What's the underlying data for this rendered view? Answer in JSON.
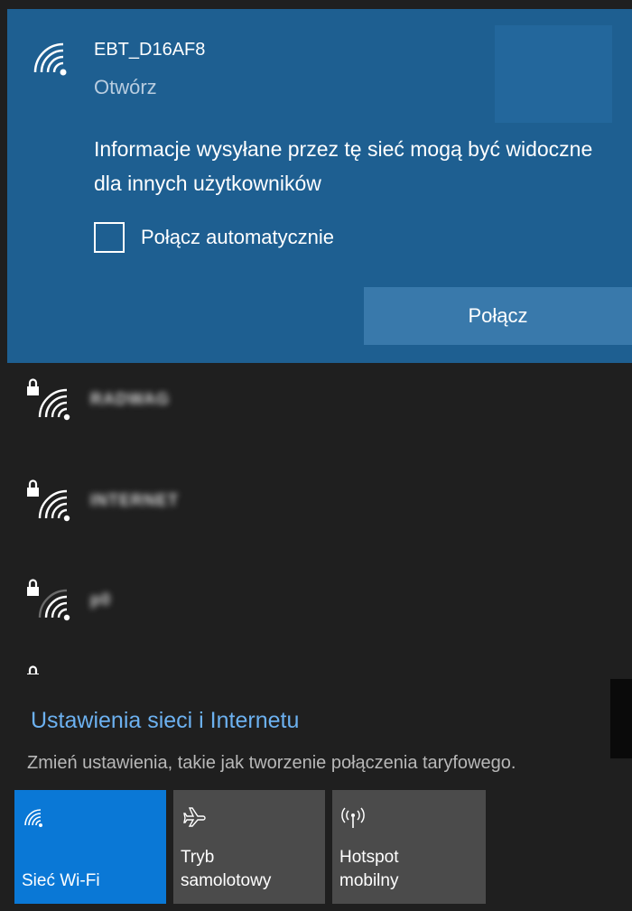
{
  "selected_network": {
    "name": "EBT_D16AF8",
    "status": "Otwórz",
    "warning": "Informacje wysyłane przez tę sieć mogą być widoczne dla innych użytkowników",
    "auto_connect_label": "Połącz automatycznie",
    "auto_connect_checked": false,
    "connect_label": "Połącz",
    "icon": "wifi-signal-icon"
  },
  "networks": [
    {
      "name": "RADWAG",
      "secured": true,
      "signal_bars": 4
    },
    {
      "name": "INTERNET",
      "secured": true,
      "signal_bars": 4
    },
    {
      "name": "p0",
      "secured": true,
      "signal_bars": 3
    },
    {
      "name": "",
      "secured": true,
      "signal_bars": 2
    }
  ],
  "settings": {
    "link": "Ustawienia sieci i Internetu",
    "description": "Zmień ustawienia, takie jak tworzenie połączenia taryfowego."
  },
  "quick_actions": [
    {
      "label_line1": "",
      "label_line2": "Sieć Wi-Fi",
      "icon": "wifi-icon",
      "active": true
    },
    {
      "label_line1": "Tryb",
      "label_line2": "samolotowy",
      "icon": "airplane-icon",
      "active": false
    },
    {
      "label_line1": "Hotspot",
      "label_line2": "mobilny",
      "icon": "hotspot-icon",
      "active": false
    }
  ],
  "colors": {
    "panel_bg": "#1f1f1f",
    "selected_bg": "#1e5f91",
    "connect_button": "#3979ab",
    "link": "#6cb1f0",
    "active_tile": "#0a78d6",
    "tile": "#4b4b4b"
  }
}
